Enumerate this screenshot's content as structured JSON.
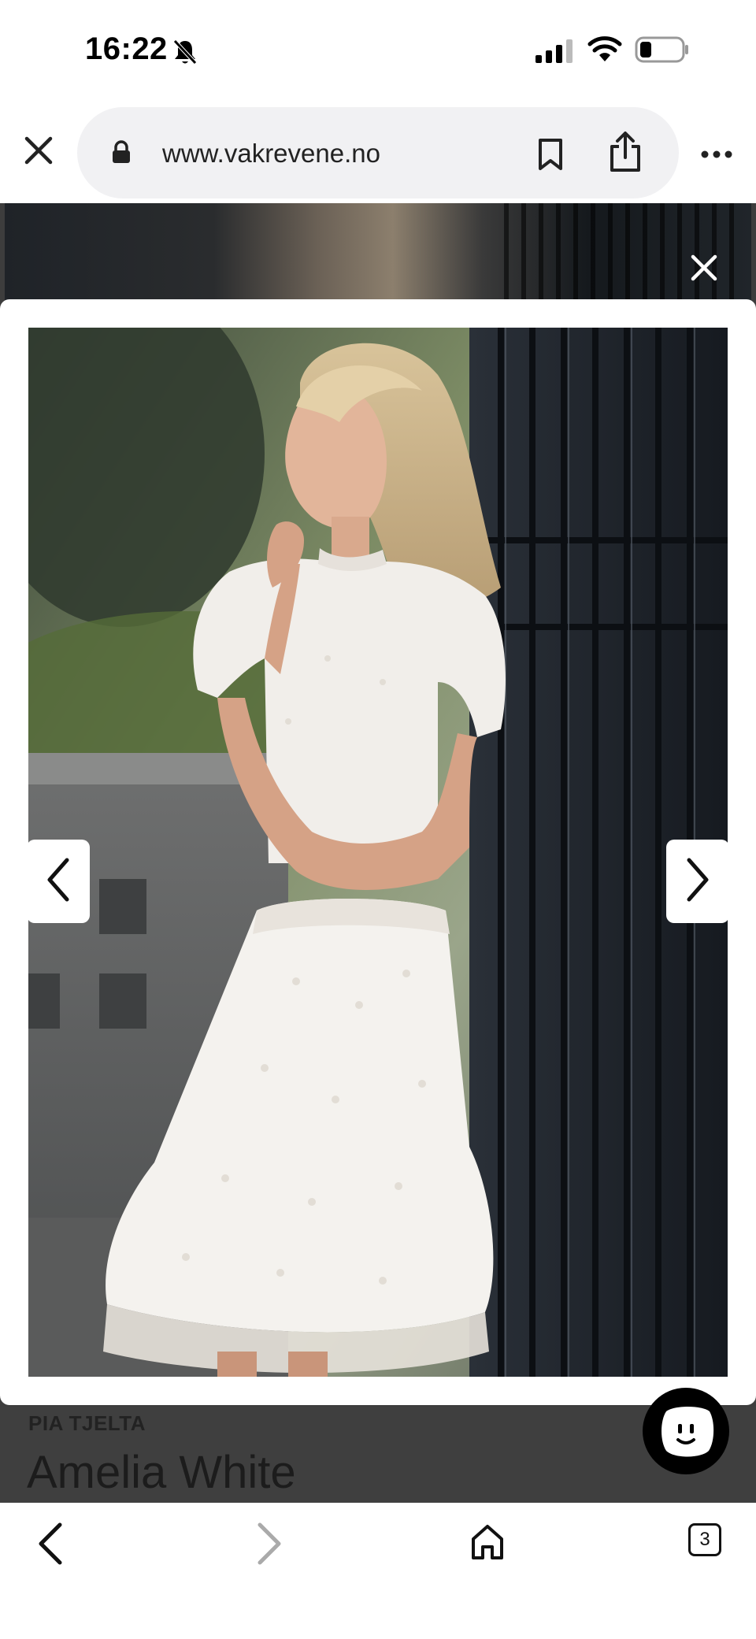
{
  "status_bar": {
    "time": "16:22",
    "icons": [
      "bell-muted-icon",
      "signal-icon",
      "wifi-icon",
      "battery-icon"
    ]
  },
  "browser": {
    "url": "www.vakrevene.no",
    "icons": [
      "close-icon",
      "lock-icon",
      "bookmark-icon",
      "share-icon",
      "more-icon"
    ]
  },
  "product": {
    "brand": "PIA TJELTA",
    "title": "Amelia White"
  },
  "lightbox": {
    "image_subject": "woman in white ruffled dress leaning against iron gate",
    "icons": [
      "close-icon",
      "chevron-left-icon",
      "chevron-right-icon"
    ]
  },
  "toolbar": {
    "tab_count": "3",
    "icons": [
      "back-icon",
      "forward-icon",
      "home-icon",
      "tabs-icon"
    ]
  },
  "colors": {
    "overlay": "#3d3d3d",
    "chat_button": "#000000",
    "url_pill": "#f1f1f3"
  }
}
